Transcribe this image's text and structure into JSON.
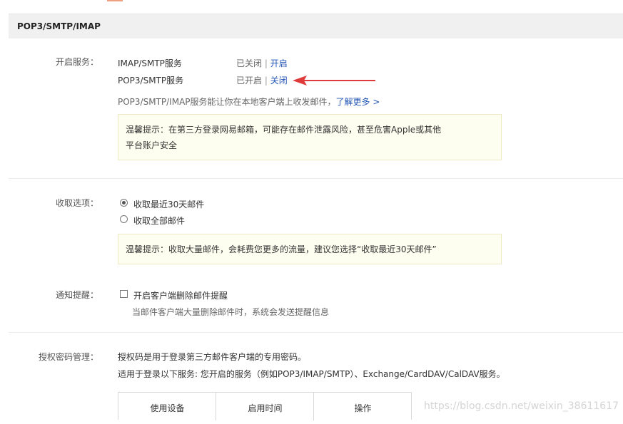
{
  "header": {
    "title": "POP3/SMTP/IMAP"
  },
  "service": {
    "label": "开启服务：",
    "rows": [
      {
        "name": "IMAP/SMTP服务",
        "status": "已关闭",
        "action": "开启"
      },
      {
        "name": "POP3/SMTP服务",
        "status": "已开启",
        "action": "关闭"
      }
    ],
    "separator": " | ",
    "description": "POP3/SMTP/IMAP服务能让你在本地客户端上收发邮件，",
    "learn_more": "了解更多 >",
    "warning_line1": "温馨提示：在第三方登录网易邮箱，可能存在邮件泄露风险，甚至危害Apple或其他",
    "warning_line2": "平台账户安全"
  },
  "receive": {
    "label": "收取选项：",
    "options": [
      {
        "text": "收取最近30天邮件",
        "checked": true
      },
      {
        "text": "收取全部邮件",
        "checked": false
      }
    ],
    "tip": "温馨提示：收取大量邮件，会耗费您更多的流量，建议您选择“收取最近30天邮件”"
  },
  "notify": {
    "label": "通知提醒：",
    "checkbox_text": "开启客户端删除邮件提醒",
    "checked": false,
    "hint": "当邮件客户端大量删除邮件时，系统会发送提醒信息"
  },
  "auth": {
    "label": "授权密码管理：",
    "line1": "授权码是用于登录第三方邮件客户端的专用密码。",
    "line2": "适用于登录以下服务: 您开启的服务（例如POP3/IMAP/SMTP）、Exchange/CardDAV/CalDAV服务。",
    "table_headers": [
      "使用设备",
      "启用时间",
      "操作"
    ]
  },
  "watermark": "https://blog.csdn.net/weixin_38611617",
  "colors": {
    "link": "#2356b6",
    "arrow": "#e03b3b",
    "notice_bg": "#fefef0"
  }
}
